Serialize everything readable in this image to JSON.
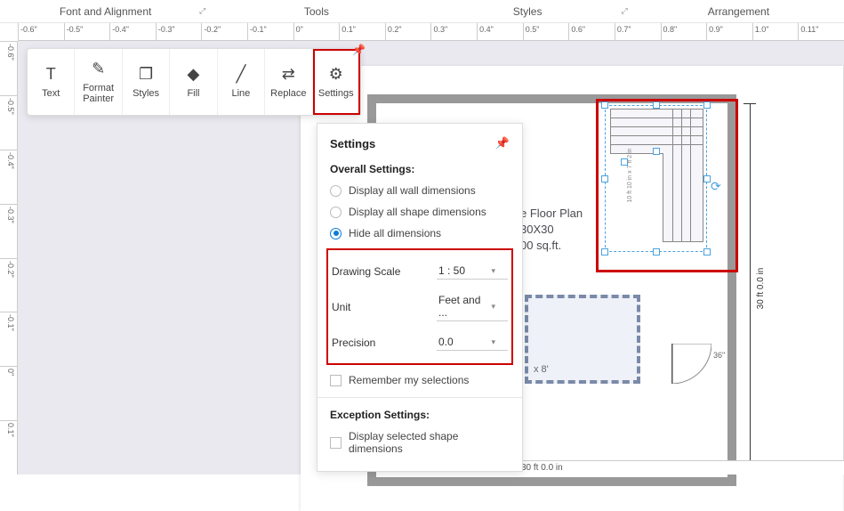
{
  "tabs": {
    "font": "Font and Alignment",
    "tools": "Tools",
    "styles": "Styles",
    "arrangement": "Arrangement"
  },
  "ruler_h": [
    "-0.6\"",
    "-0.5\"",
    "-0.4\"",
    "-0.3\"",
    "-0.2\"",
    "-0.1\"",
    "0\"",
    "0.1\"",
    "0.2\"",
    "0.3\"",
    "0.4\"",
    "0.5\"",
    "0.6\"",
    "0.7\"",
    "0.8\"",
    "0.9\"",
    "1.0\"",
    "0.11\""
  ],
  "ruler_v": [
    "-0.6\"",
    "-0.5\"",
    "-0.4\"",
    "-0.3\"",
    "-0.2\"",
    "-0.1\"",
    "0\"",
    "0.1\""
  ],
  "toolbar": {
    "text": "Text",
    "format_painter": "Format Painter",
    "styles": "Styles",
    "fill": "Fill",
    "line": "Line",
    "replace": "Replace",
    "settings": "Settings"
  },
  "settings": {
    "title": "Settings",
    "overall": "Overall Settings:",
    "opt_wall": "Display all wall dimensions",
    "opt_shape": "Display all shape dimensions",
    "opt_hide": "Hide all dimensions",
    "scale_label": "Drawing Scale",
    "scale_value": "1 : 50",
    "unit_label": "Unit",
    "unit_value": "Feet and ...",
    "precision_label": "Precision",
    "precision_value": "0.0",
    "remember": "Remember my selections",
    "exception": "Exception Settings:",
    "exc_sel": "Display selected shape dimensions"
  },
  "floor": {
    "line1": "e Floor Plan",
    "line2": "30X30",
    "line3": "00 sq.ft."
  },
  "dim_main": "30 ft 0.0 in",
  "dim_door": "36\"",
  "room_label": "x 8'",
  "stairs_dim": "10 ft 10 in x 7 ft 2 in",
  "bottom_readout": "30 ft 0.0 in"
}
